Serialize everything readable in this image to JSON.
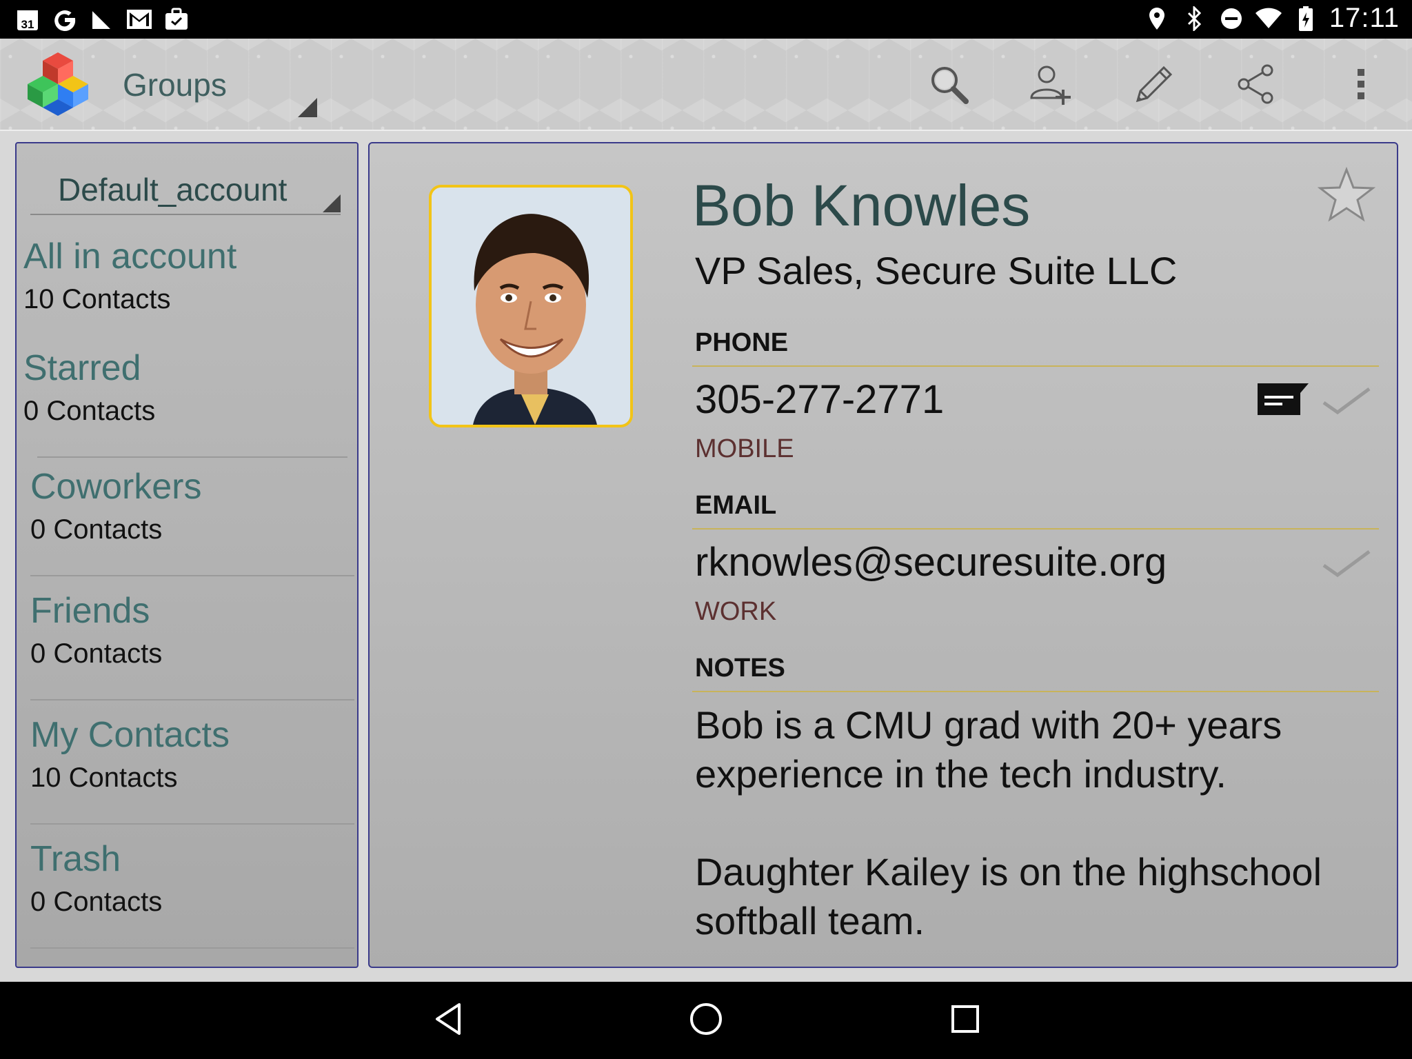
{
  "status_bar": {
    "time": "17:11",
    "left_icons": [
      "calendar-icon",
      "google-icon",
      "no-signal-icon",
      "gmail-icon",
      "briefcase-icon"
    ],
    "calendar_day": "31",
    "right_icons": [
      "location-icon",
      "bluetooth-icon",
      "do-not-disturb-icon",
      "wifi-icon",
      "battery-icon"
    ]
  },
  "app_bar": {
    "title": "Groups",
    "actions": [
      "search-icon",
      "add-contact-icon",
      "edit-icon",
      "share-icon",
      "overflow-menu-icon"
    ]
  },
  "groups_panel": {
    "account": "Default_account",
    "groups": [
      {
        "name": "All in account",
        "count": "10 Contacts"
      },
      {
        "name": "Starred",
        "count": "0 Contacts"
      },
      {
        "name": "Coworkers",
        "count": "0 Contacts"
      },
      {
        "name": "Friends",
        "count": "0 Contacts"
      },
      {
        "name": "My Contacts",
        "count": "10 Contacts"
      },
      {
        "name": "Trash",
        "count": "0 Contacts"
      }
    ]
  },
  "contact": {
    "name": "Bob Knowles",
    "title": "VP Sales, Secure Suite LLC",
    "phone_header": "PHONE",
    "phone": "305-277-2771",
    "phone_type": "MOBILE",
    "email_header": "EMAIL",
    "email": "rknowles@securesuite.org",
    "email_type": "WORK",
    "notes_header": "NOTES",
    "notes": "Bob is a CMU grad with 20+ years experience in the tech industry.\n\nDaughter Kailey is on the highschool softball team."
  },
  "colors": {
    "accent_green": "#3f6f6f",
    "photo_border": "#f2c417",
    "panel_border": "#3a3a8a",
    "type_label": "#5c3030"
  },
  "nav_bar": {
    "buttons": [
      "back-icon",
      "home-icon",
      "recents-icon"
    ]
  }
}
